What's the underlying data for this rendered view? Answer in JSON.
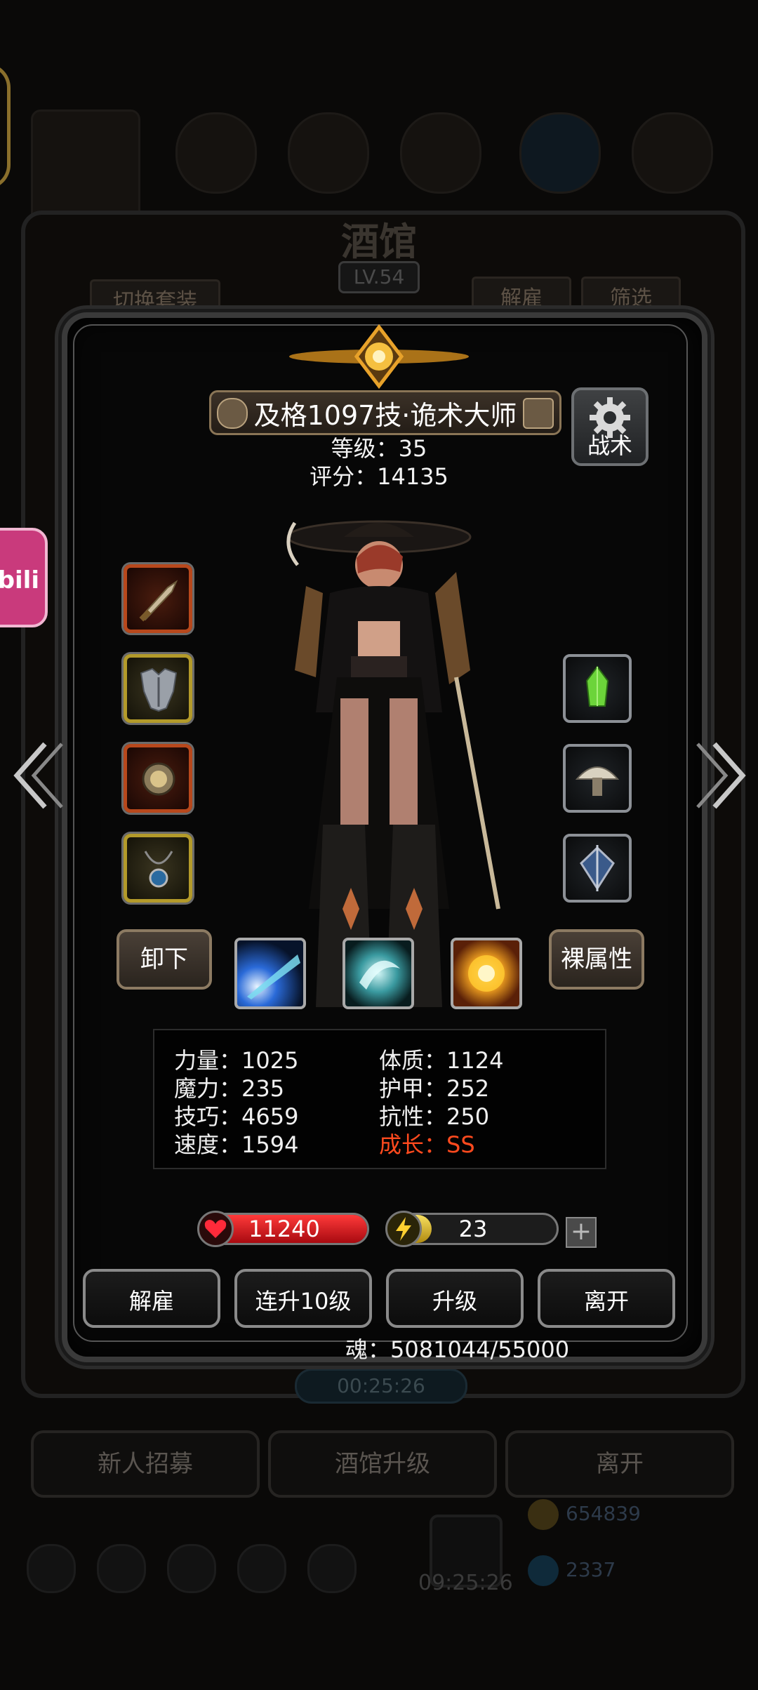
{
  "background": {
    "title": "酒馆",
    "level": "LV.54",
    "switch_outfit": "切换套装",
    "dismiss": "解雇",
    "filter": "筛选",
    "timer": "00:25:26",
    "recruit": "新人招募",
    "upgrade_tavern": "酒馆升级",
    "leave": "离开",
    "currency_gold": "654839",
    "currency_gem": "2337",
    "bottom_timer": "09:25:26",
    "bili_label": "bili"
  },
  "hero": {
    "name": "及格1097技·诡术大师",
    "level_text": "等级：35",
    "score_text": "评分：14135",
    "tactics_label": "战术",
    "unequip_label": "卸下",
    "naked_attr_label": "裸属性",
    "attributes": {
      "strength": "力量：1025",
      "magic": "魔力：235",
      "skill": "技巧：4659",
      "speed": "速度：1594",
      "constitution": "体质：1124",
      "armor": "护甲：252",
      "resistance": "抗性：250",
      "growth": "成长：SS"
    },
    "hp": "11240",
    "energy": "23",
    "energy_fraction": 0.25,
    "soul_text": "魂：5081044/55000"
  },
  "actions": {
    "dismiss": "解雇",
    "level_up_10": "连升10级",
    "level_up": "升级",
    "leave": "离开"
  },
  "icons": {
    "tactics": "gear-icon",
    "hp": "heart-icon",
    "energy": "lightning-icon",
    "prev": "chevron-left-icon",
    "next": "chevron-right-icon"
  },
  "colors": {
    "hp_bar": "#d4141c",
    "energy_bar": "#d6b21a",
    "growth_text": "#ff4a1e",
    "slot_red": "#b8481c",
    "slot_gold": "#b39a2a"
  }
}
